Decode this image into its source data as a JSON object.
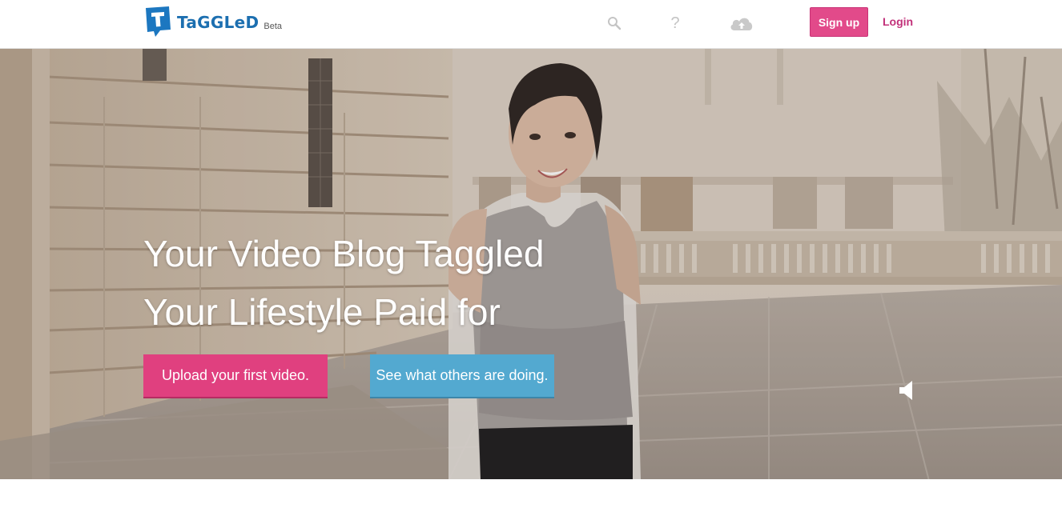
{
  "header": {
    "logo_text": "TaGGLeD",
    "logo_badge": "Beta",
    "icons": [
      "search-icon",
      "help-icon",
      "cloud-upload-icon"
    ],
    "help_glyph": "?",
    "signup_label": "Sign up",
    "login_label": "Login"
  },
  "hero": {
    "headline_line1": "Your Video Blog Taggled",
    "headline_line2": "Your Lifestyle Paid for",
    "upload_button": "Upload your first video.",
    "others_button": "See what others are doing.",
    "mute_icon": "speaker-icon"
  },
  "colors": {
    "brand_blue": "#1c6fb0",
    "signup_pink": "#e24a8a",
    "login_pink": "#c2317a",
    "upload_pink": "#e0407f",
    "others_blue": "#53a9d0"
  }
}
